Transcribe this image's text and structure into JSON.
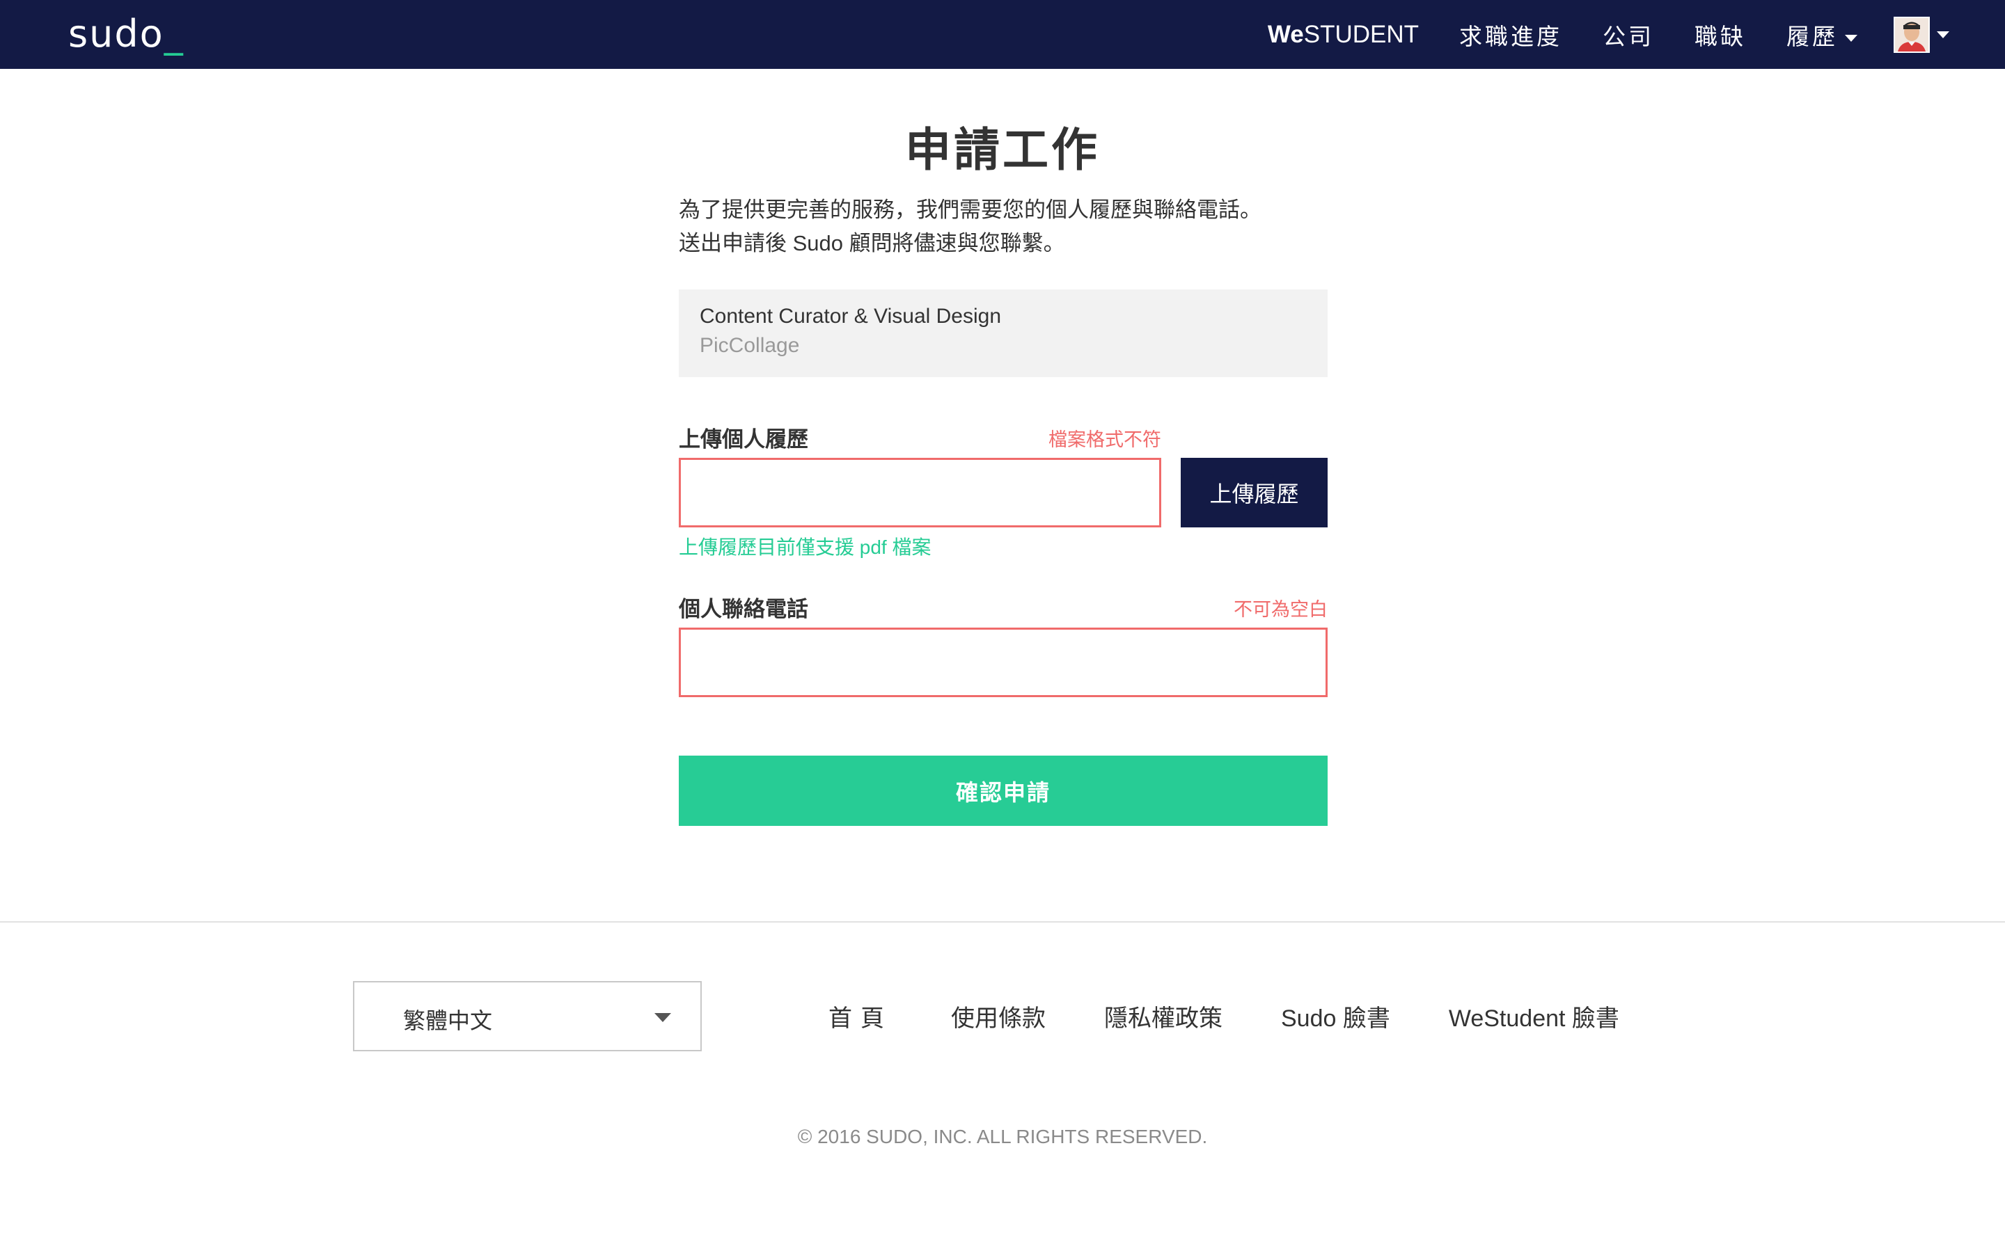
{
  "header": {
    "logo": "sudo",
    "logo_cursor": "_",
    "nav": {
      "westudent_we": "We",
      "westudent_student": "STUDENT",
      "progress": "求職進度",
      "company": "公司",
      "jobs": "職缺",
      "resume": "履歷"
    }
  },
  "main": {
    "title": "申請工作",
    "intro_line1": "為了提供更完善的服務，我們需要您的個人履歷與聯絡電話。",
    "intro_line2": "送出申請後 Sudo 顧問將儘速與您聯繫。",
    "job": {
      "title": "Content Curator & Visual Design",
      "company": "PicCollage"
    },
    "resume_field": {
      "label": "上傳個人履歷",
      "error": "檔案格式不符",
      "value": "",
      "upload_button": "上傳履歷",
      "hint": "上傳履歷目前僅支援 pdf 檔案"
    },
    "phone_field": {
      "label": "個人聯絡電話",
      "error": "不可為空白",
      "value": ""
    },
    "submit_label": "確認申請"
  },
  "footer": {
    "language": "繁體中文",
    "links": {
      "home": "首頁",
      "terms": "使用條款",
      "privacy": "隱私權政策",
      "sudo_fb": "Sudo 臉書",
      "westudent_fb": "WeStudent 臉書"
    },
    "copyright": "© 2016 SUDO, INC. ALL RIGHTS RESERVED."
  },
  "colors": {
    "navbar": "#131a45",
    "accent_green": "#27cc95",
    "error_red": "#f06b6b"
  },
  "icons": {
    "resume_menu": "chevron-down-icon",
    "user_menu": "chevron-down-icon",
    "language": "chevron-down-icon"
  }
}
